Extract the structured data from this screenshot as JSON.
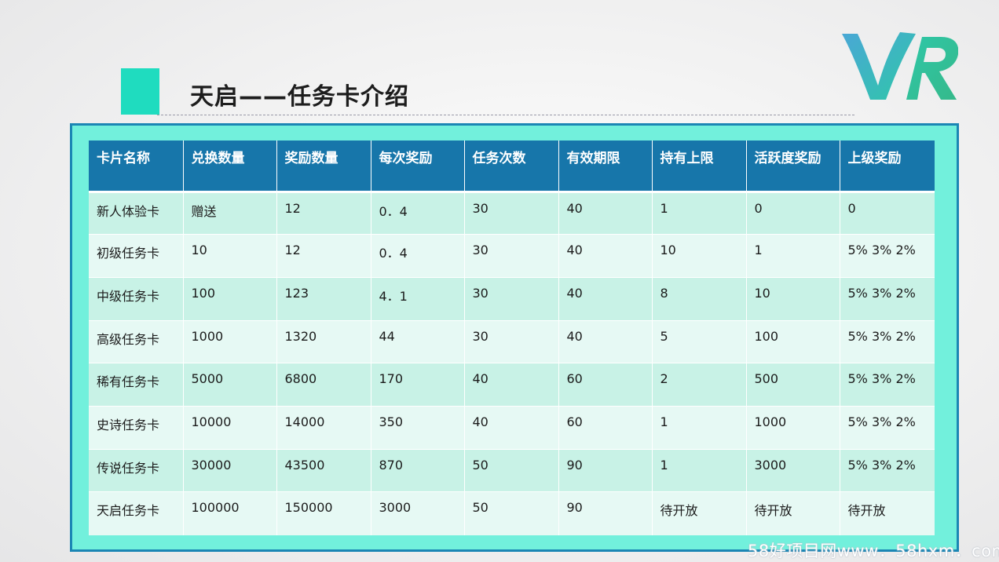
{
  "slide": {
    "title": "天启——任务卡介绍",
    "logo_text": "VR"
  },
  "table": {
    "headers": [
      "卡片名称",
      "兑换数量",
      "奖励数量",
      "每次奖励",
      "任务次数",
      "有效期限",
      "持有上限",
      "活跃度奖励",
      "上级奖励"
    ],
    "rows": [
      [
        "新人体验卡",
        "赠送",
        "12",
        "0．4",
        "30",
        "40",
        "1",
        "0",
        "0"
      ],
      [
        "初级任务卡",
        "10",
        "12",
        "0．4",
        "30",
        "40",
        "10",
        "1",
        "5%  3%  2%"
      ],
      [
        "中级任务卡",
        "100",
        "123",
        "4．1",
        "30",
        "40",
        "8",
        "10",
        "5%  3%  2%"
      ],
      [
        "高级任务卡",
        "1000",
        "1320",
        "44",
        "30",
        "40",
        "5",
        "100",
        "5%  3%  2%"
      ],
      [
        "稀有任务卡",
        "5000",
        "6800",
        "170",
        "40",
        "60",
        "2",
        "500",
        "5%  3%  2%"
      ],
      [
        "史诗任务卡",
        "10000",
        "14000",
        "350",
        "40",
        "60",
        "1",
        "1000",
        "5%  3%  2%"
      ],
      [
        "传说任务卡",
        "30000",
        "43500",
        "870",
        "50",
        "90",
        "1",
        "3000",
        "5%  3%  2%"
      ],
      [
        "天启任务卡",
        "100000",
        "150000",
        "3000",
        "50",
        "90",
        "待开放",
        "待开放",
        "待开放"
      ]
    ]
  },
  "watermark": "58好项目网www．58hxm．com",
  "colors": {
    "accent": "#1fdcbf",
    "frame": "#72f0dc",
    "frame_border": "#1b86b4",
    "header_bg": "#1776aa",
    "row_odd": "#c8f2e6",
    "row_even": "#e6f9f4",
    "logo_v": "#3bb8c8",
    "logo_r": "#2fc79c"
  }
}
